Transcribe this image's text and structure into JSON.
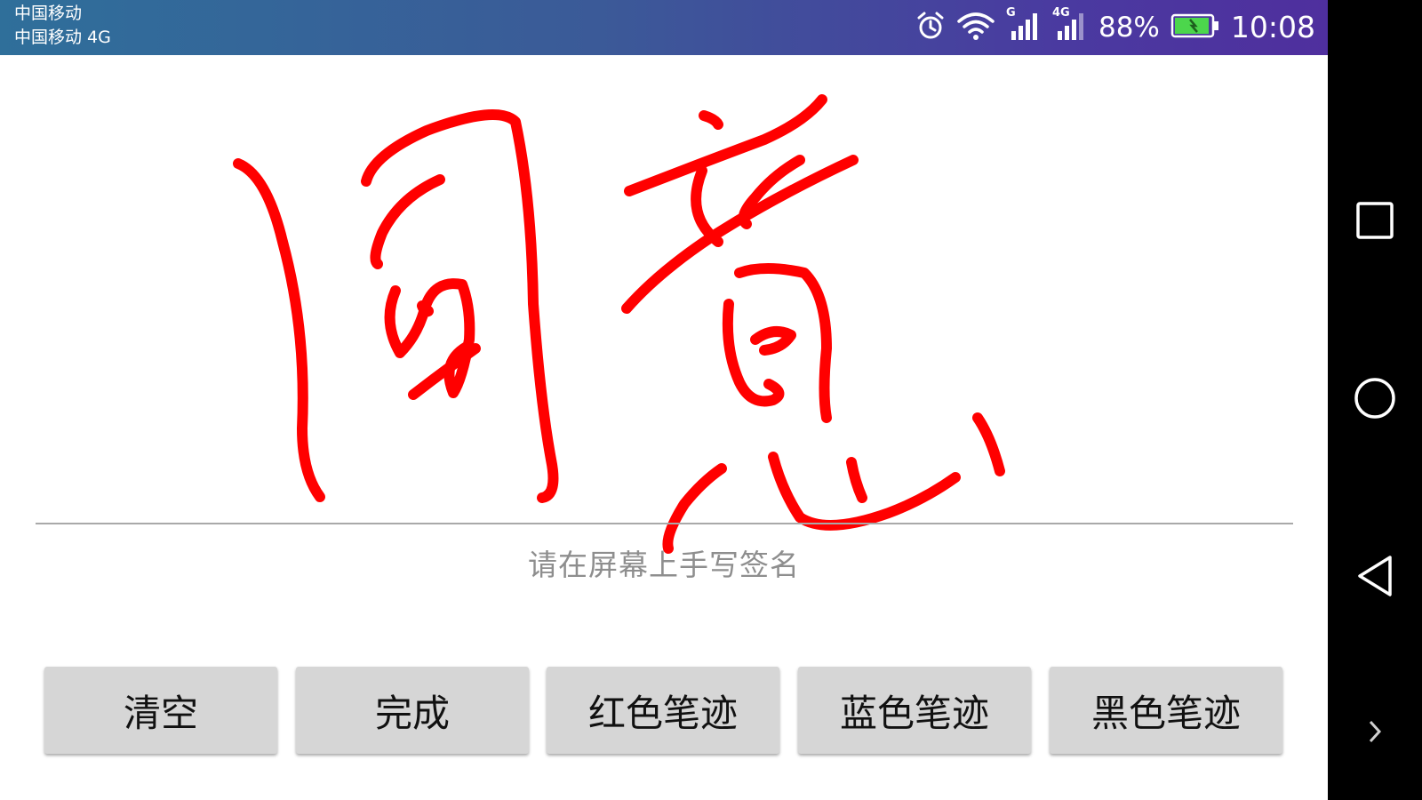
{
  "status_bar": {
    "carrier_1": "中国移动",
    "carrier_2": "中国移动 4G",
    "network_1": "G",
    "network_2": "4G",
    "battery_pct": "88%",
    "time": "10:08",
    "icons": [
      "alarm-icon",
      "wifi-icon",
      "signal-icon",
      "battery-charging-icon"
    ]
  },
  "signature": {
    "stroke_color": "#ff0000",
    "hint": "请在屏幕上手写签名"
  },
  "buttons": {
    "clear": "清空",
    "done": "完成",
    "red": "红色笔迹",
    "blue": "蓝色笔迹",
    "black": "黑色笔迹"
  },
  "nav_bar": {
    "icons": [
      "recent-apps-icon",
      "home-icon",
      "back-icon",
      "expand-icon"
    ]
  }
}
